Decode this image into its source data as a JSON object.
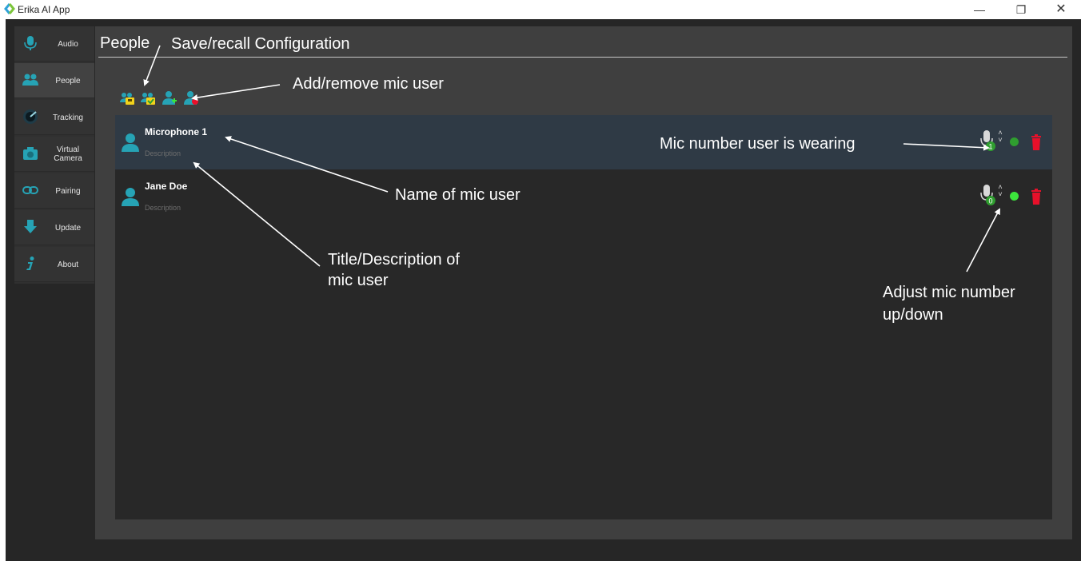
{
  "window": {
    "title": "Erika AI App",
    "controls": {
      "minimize": "—",
      "maximize": "❐",
      "close": "✕"
    }
  },
  "sidebar": {
    "items": [
      {
        "label": "Audio",
        "icon": "microphone-icon"
      },
      {
        "label": "People",
        "icon": "people-icon",
        "active": true
      },
      {
        "label": "Tracking",
        "icon": "tracking-icon"
      },
      {
        "label": "Virtual Camera",
        "icon": "camera-icon"
      },
      {
        "label": "Pairing",
        "icon": "link-icon"
      },
      {
        "label": "Update",
        "icon": "update-icon"
      },
      {
        "label": "About",
        "icon": "info-icon"
      }
    ]
  },
  "main": {
    "title": "People",
    "toolbar": [
      {
        "icon": "save-config-icon"
      },
      {
        "icon": "recall-config-icon"
      },
      {
        "icon": "add-user-icon"
      },
      {
        "icon": "remove-user-icon"
      }
    ],
    "users": [
      {
        "name": "Microphone 1",
        "description": "Description",
        "mic_number": "1",
        "status_color": "#2f9e2f",
        "selected": true
      },
      {
        "name": "Jane Doe",
        "description": "Description",
        "mic_number": "0",
        "status_color": "#3ce63c",
        "selected": false
      }
    ]
  },
  "annotations": {
    "save_recall": "Save/recall Configuration",
    "add_remove": "Add/remove mic user",
    "mic_number": "Mic number user is wearing",
    "name": "Name of mic user",
    "title_desc_line1": "Title/Description of",
    "title_desc_line2": "mic user",
    "adjust_line1": "Adjust mic number",
    "adjust_line2": "up/down"
  },
  "colors": {
    "accent": "#26a3b5",
    "danger": "#e8102a",
    "frame": "#262626",
    "panel": "#3f3f3f",
    "list": "#282828"
  }
}
